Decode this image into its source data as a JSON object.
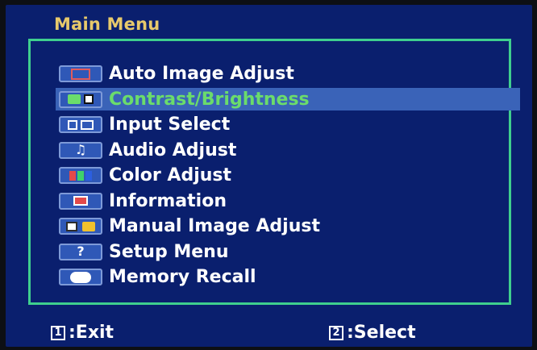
{
  "title": "Main Menu",
  "menu": {
    "items": [
      {
        "label": "Auto Image Adjust",
        "icon": "auto-image-adjust-icon"
      },
      {
        "label": "Contrast/Brightness",
        "icon": "contrast-brightness-icon",
        "selected": true
      },
      {
        "label": "Input Select",
        "icon": "input-select-icon"
      },
      {
        "label": "Audio Adjust",
        "icon": "audio-adjust-icon"
      },
      {
        "label": "Color Adjust",
        "icon": "color-adjust-icon"
      },
      {
        "label": "Information",
        "icon": "information-icon"
      },
      {
        "label": "Manual Image Adjust",
        "icon": "manual-image-adjust-icon"
      },
      {
        "label": "Setup Menu",
        "icon": "setup-menu-icon"
      },
      {
        "label": "Memory Recall",
        "icon": "memory-recall-icon"
      }
    ]
  },
  "footer": {
    "exit_key": "1",
    "exit_label": ":Exit",
    "select_key": "2",
    "select_label": ":Select"
  },
  "colors": {
    "screen_bg": "#0a1f6e",
    "border": "#3fcf8e",
    "title": "#e7c96b",
    "selected_text": "#6bdc6b",
    "selected_bg": "#3a63b8"
  }
}
